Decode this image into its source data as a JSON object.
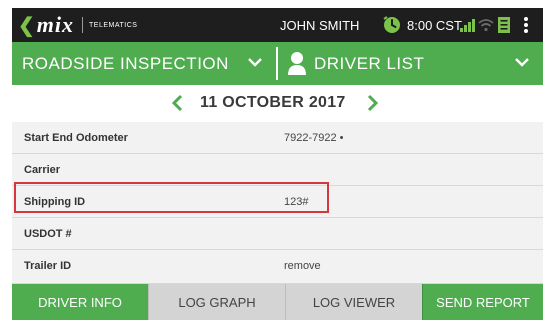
{
  "status_bar": {
    "logo_text": "mix",
    "logo_subtext": "TELEMATICS",
    "user_name": "JOHN SMITH",
    "time": "8:00 CST"
  },
  "header": {
    "left_label": "ROADSIDE INSPECTION",
    "right_label": "DRIVER LIST"
  },
  "date_nav": {
    "date": "11 OCTOBER 2017"
  },
  "rows": [
    {
      "label": "Start End Odometer",
      "value": "7922-7922 •"
    },
    {
      "label": "Carrier",
      "value": ""
    },
    {
      "label": "Shipping ID",
      "value": "123#"
    },
    {
      "label": "USDOT #",
      "value": ""
    },
    {
      "label": "Trailer ID",
      "value": "remove"
    }
  ],
  "tabs": {
    "driver_info": "DRIVER INFO",
    "log_graph": "LOG GRAPH",
    "log_viewer": "LOG VIEWER",
    "send_report": "SEND REPORT"
  },
  "colors": {
    "accent_green": "#4fad50",
    "status_bar_bg": "#1e1e1e",
    "highlight_red": "#d6373c",
    "inactive_tab": "#d4d4d4"
  }
}
